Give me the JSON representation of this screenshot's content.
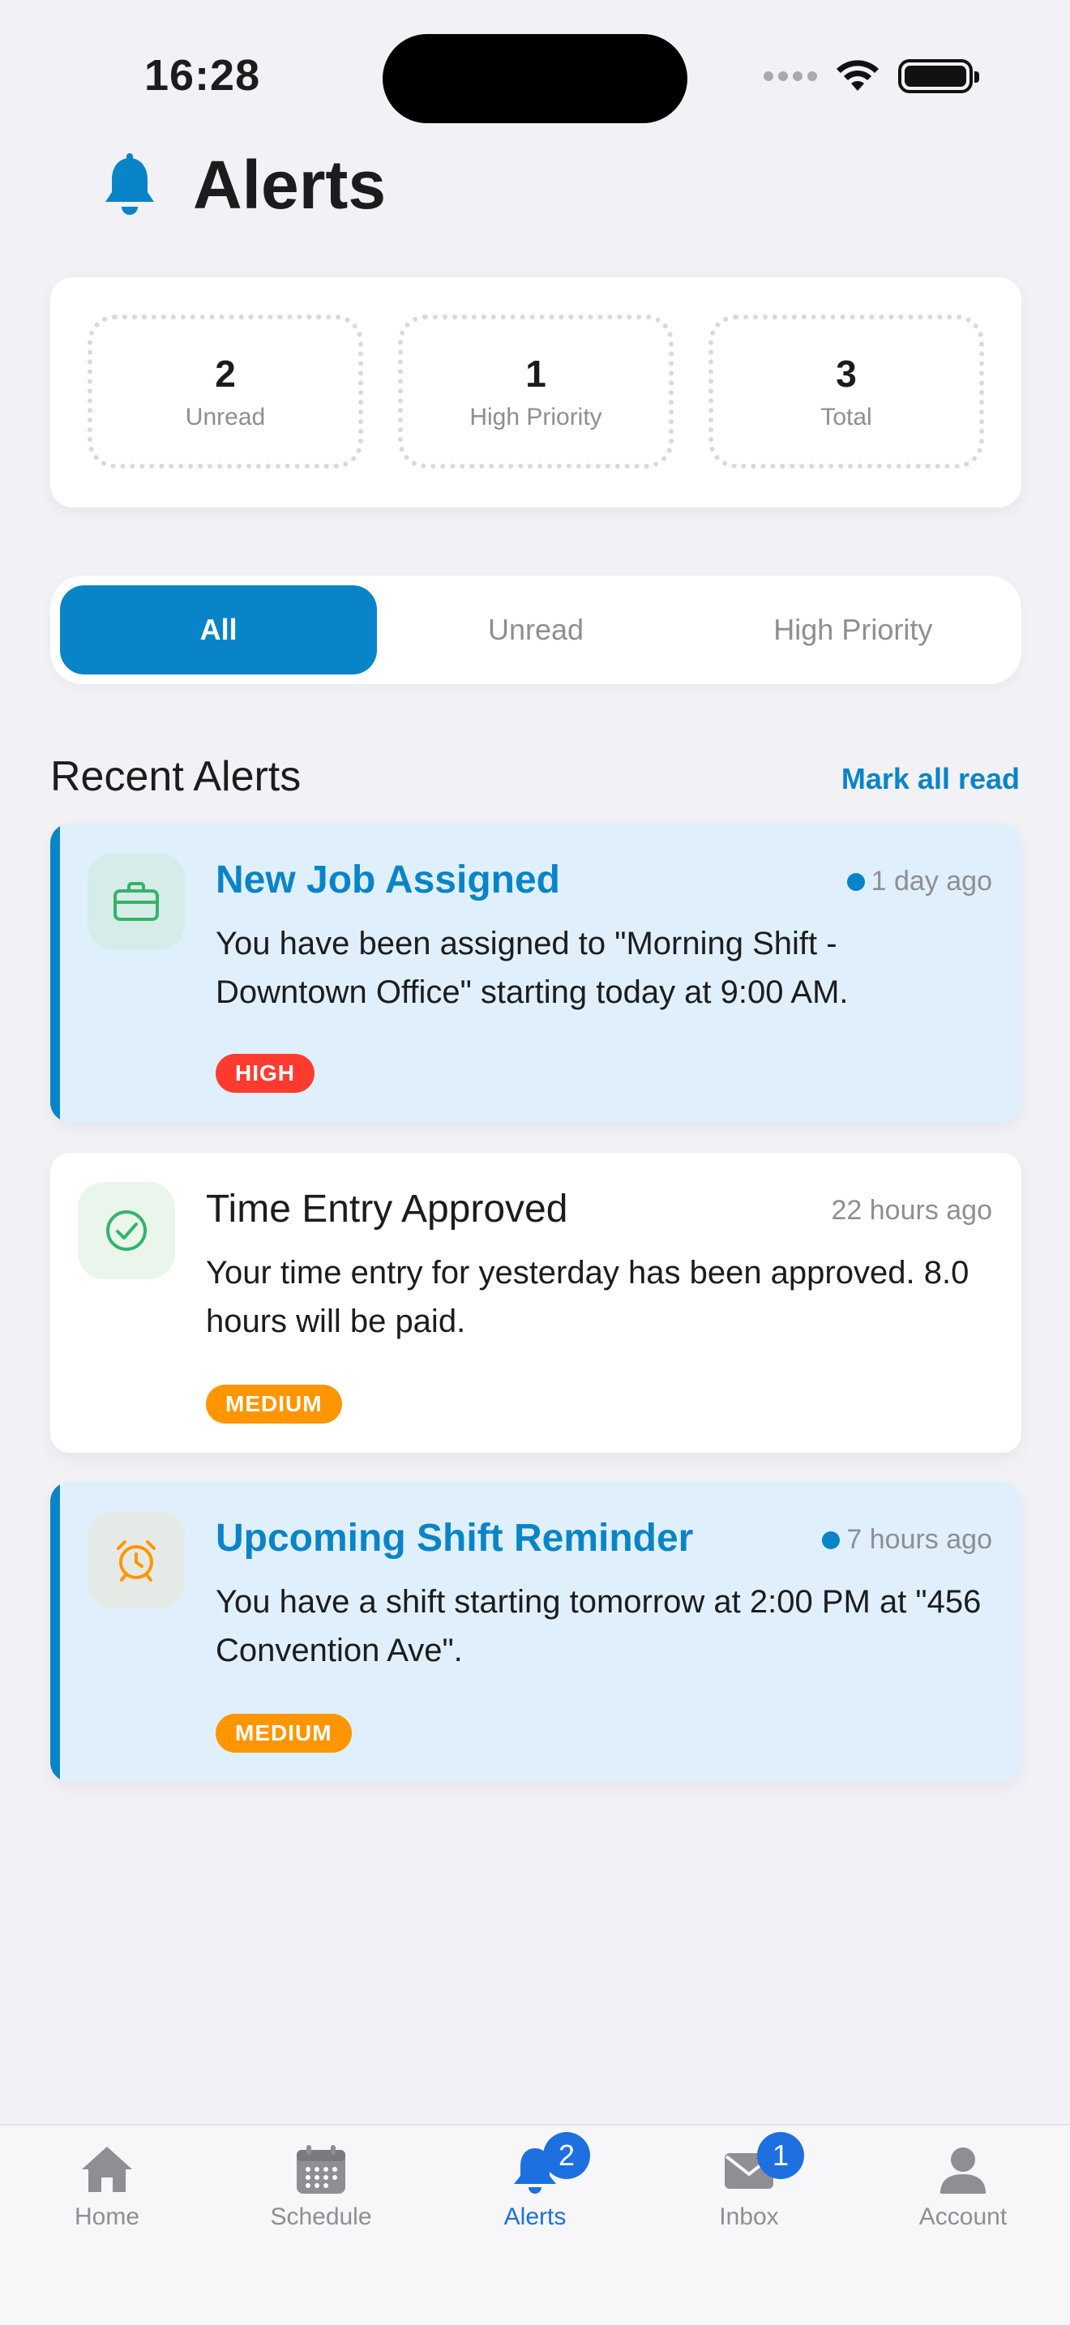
{
  "status_bar": {
    "time": "16:28"
  },
  "header": {
    "title": "Alerts"
  },
  "stats": [
    {
      "value": "2",
      "label": "Unread"
    },
    {
      "value": "1",
      "label": "High Priority"
    },
    {
      "value": "3",
      "label": "Total"
    }
  ],
  "filters": [
    {
      "label": "All",
      "active": true
    },
    {
      "label": "Unread",
      "active": false
    },
    {
      "label": "High Priority",
      "active": false
    }
  ],
  "section": {
    "title": "Recent Alerts",
    "action": "Mark all read"
  },
  "alerts": [
    {
      "title": "New Job Assigned",
      "time": "1 day ago",
      "unread": true,
      "icon": "briefcase-icon",
      "body": "You have been assigned to \"Morning Shift - Downtown Office\" starting today at 9:00 AM.",
      "priority": "HIGH"
    },
    {
      "title": "Time Entry Approved",
      "time": "22 hours ago",
      "unread": false,
      "icon": "check-circle-icon",
      "body": "Your time entry for yesterday has been approved. 8.0 hours will be paid.",
      "priority": "MEDIUM"
    },
    {
      "title": "Upcoming Shift Reminder",
      "time": "7 hours ago",
      "unread": true,
      "icon": "alarm-clock-icon",
      "body": "You have a shift starting tomorrow at 2:00 PM at \"456 Convention Ave\".",
      "priority": "MEDIUM"
    }
  ],
  "tab_bar": [
    {
      "label": "Home",
      "icon": "home-icon"
    },
    {
      "label": "Schedule",
      "icon": "calendar-icon"
    },
    {
      "label": "Alerts",
      "icon": "bell-icon",
      "badge": "2",
      "active": true
    },
    {
      "label": "Inbox",
      "icon": "mail-icon",
      "badge": "1"
    },
    {
      "label": "Account",
      "icon": "person-icon"
    }
  ],
  "colors": {
    "accent": "#0a84c8",
    "tab_active": "#1e6fe0",
    "high": "#ff3b30",
    "medium": "#ff9500",
    "unread_bg": "#dff0fc"
  }
}
